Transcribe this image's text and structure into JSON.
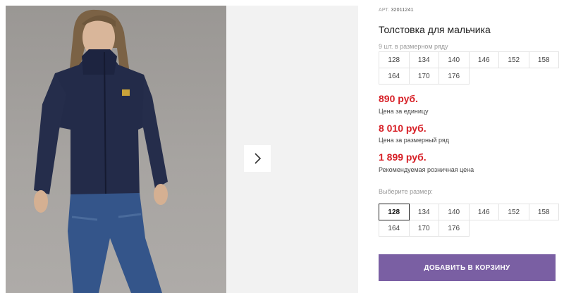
{
  "product": {
    "art_prefix": "АРТ.",
    "art_number": "32011241",
    "title": "Толстовка для мальчика",
    "size_row_note": "9 шт. в размерном ряду",
    "size_row": [
      "128",
      "134",
      "140",
      "146",
      "152",
      "158",
      "164",
      "170",
      "176"
    ],
    "prices": [
      {
        "value": "890 руб.",
        "label": "Цена за единицу"
      },
      {
        "value": "8 010 руб.",
        "label": "Цена за размерный ряд"
      },
      {
        "value": "1 899 руб.",
        "label": "Рекомендуемая розничная цена"
      }
    ],
    "choose_label": "Выберите размер:",
    "choose_sizes": [
      "128",
      "134",
      "140",
      "146",
      "152",
      "158",
      "164",
      "170",
      "176"
    ],
    "selected_size": "128",
    "cart_button": "ДОБАВИТЬ В КОРЗИНУ"
  },
  "colors": {
    "price_red": "#d71f26",
    "button_purple": "#7a5fa3"
  },
  "icons": {
    "next": "chevron-right-icon"
  }
}
